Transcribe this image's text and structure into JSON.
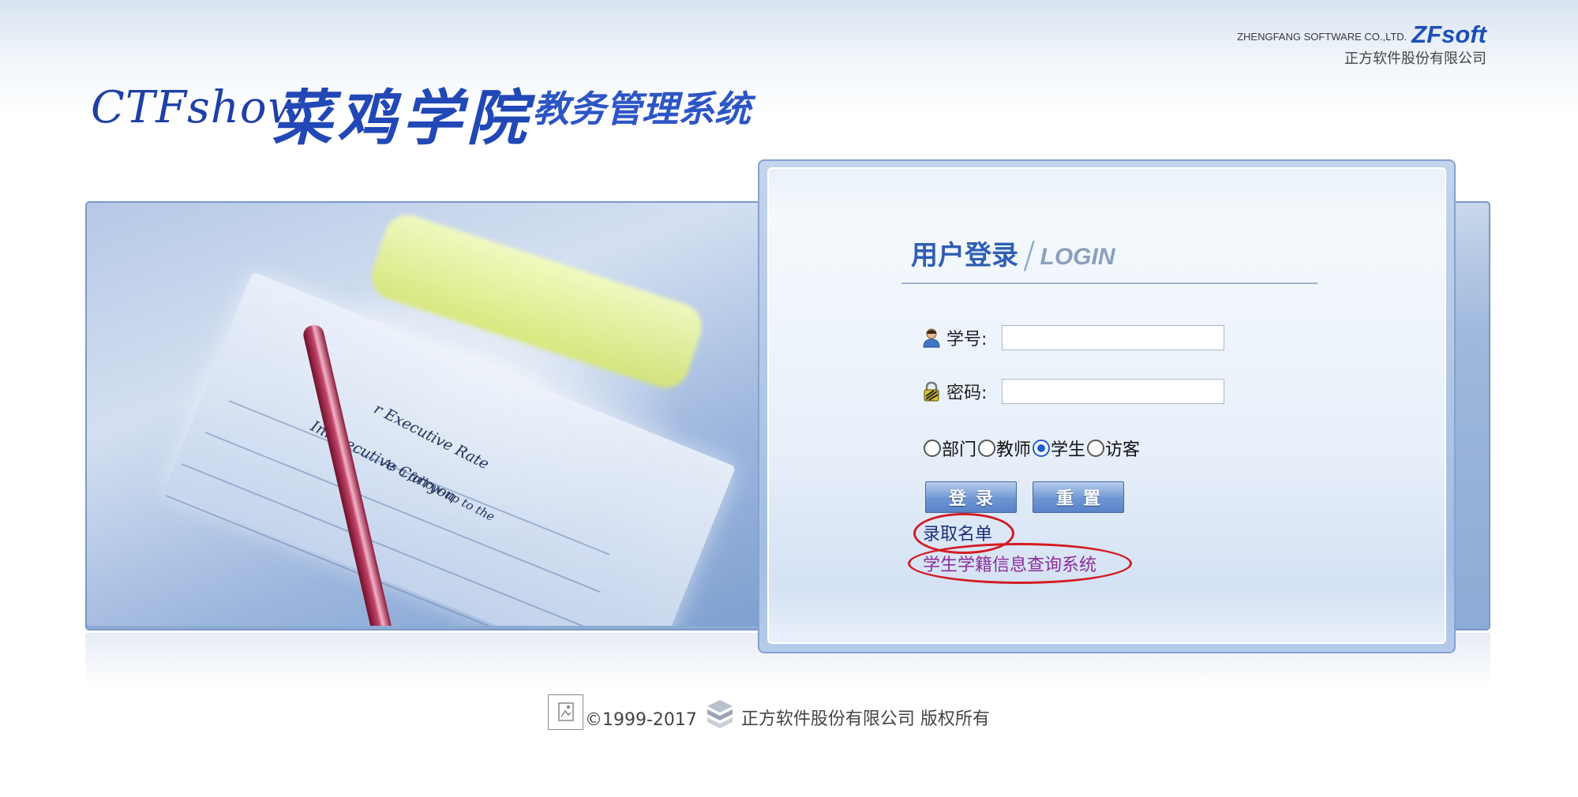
{
  "header": {
    "brand_prefix": "CTFshow",
    "school_name": "菜鸡学院",
    "system_name": "教务管理系统",
    "vendor_en": "ZHENGFANG SOFTWARE CO.,LTD.",
    "vendor_brand": "ZFsoft",
    "vendor_cn": "正方软件股份有限公司"
  },
  "photo": {
    "text_lines": [
      "r Executive Rate",
      "Inn    xecutive Carryon",
      "As a follow-up to the"
    ]
  },
  "login": {
    "title_cn": "用户登录",
    "title_en": "LOGIN",
    "username_label": "学号:",
    "password_label": "密码:",
    "username_value": "",
    "password_value": "",
    "roles": [
      {
        "label": "部门",
        "selected": false
      },
      {
        "label": "教师",
        "selected": false
      },
      {
        "label": "学生",
        "selected": true
      },
      {
        "label": "访客",
        "selected": false
      }
    ],
    "login_button": "登录",
    "reset_button": "重置",
    "admission_link": "录取名单",
    "records_link": "学生学籍信息查询系统"
  },
  "annotation": {
    "color": "#d41c24"
  },
  "footer": {
    "copyright": "©1999-2017",
    "company": "正方软件股份有限公司 版权所有"
  }
}
